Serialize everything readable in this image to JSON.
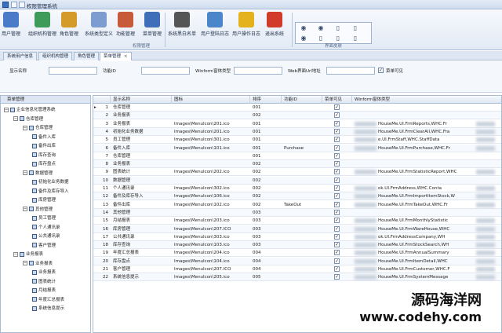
{
  "window": {
    "title": "权限管理系统"
  },
  "ribbon": {
    "buttons": [
      {
        "label": "用户管理",
        "icon": "users-icon",
        "color": "#4a7bc8"
      },
      {
        "label": "组织机构管理",
        "icon": "org-icon",
        "color": "#3f9b5a"
      },
      {
        "label": "角色管理",
        "icon": "role-icon",
        "color": "#d49a2a"
      },
      {
        "label": "系统类型定义",
        "icon": "type-define-icon",
        "color": "#7d9ccf"
      },
      {
        "label": "功能管理",
        "icon": "function-icon",
        "color": "#c85a3a"
      },
      {
        "label": "菜单管理",
        "icon": "menu-icon",
        "color": "#3f6fb8"
      },
      {
        "label": "系统黑白名单",
        "icon": "blacklist-icon",
        "color": "#555555"
      },
      {
        "label": "用户登陆日志",
        "icon": "login-log-icon",
        "color": "#4a86c9"
      },
      {
        "label": "用户操作日志",
        "icon": "warning-icon",
        "color": "#e3b21c"
      },
      {
        "label": "退出系统",
        "icon": "exit-icon",
        "color": "#d23a2a"
      }
    ],
    "group_label": "权限管理",
    "theme_label": "界面皮肤"
  },
  "tabs": [
    {
      "label": "系统用户信息"
    },
    {
      "label": "组织机构管理"
    },
    {
      "label": "角色管理"
    },
    {
      "label": "菜单管理",
      "close": "×"
    }
  ],
  "filter": {
    "display_name_label": "显示名称",
    "function_id_label": "功能ID",
    "winform_type_label": "Winform窗体类型",
    "web_url_label": "Web界面Url地址",
    "menu_visible_label": "菜单可见",
    "menu_visible_checked": true
  },
  "tree": {
    "title": "菜单管理",
    "nodes": [
      {
        "label": "企业信息化管理系统",
        "level": 0,
        "expanded": true
      },
      {
        "label": "仓库管理",
        "level": 1,
        "expanded": true
      },
      {
        "label": "仓库管理",
        "level": 2,
        "expanded": true
      },
      {
        "label": "备件入库",
        "level": 3
      },
      {
        "label": "备件出库",
        "level": 3
      },
      {
        "label": "库存查询",
        "level": 3
      },
      {
        "label": "库存盘点",
        "level": 3
      },
      {
        "label": "数据管理",
        "level": 2,
        "expanded": true
      },
      {
        "label": "初始化业务数据",
        "level": 3
      },
      {
        "label": "备件及库存导入",
        "level": 3
      },
      {
        "label": "库房管理",
        "level": 3
      },
      {
        "label": "其他管理",
        "level": 2,
        "expanded": true
      },
      {
        "label": "员工管理",
        "level": 3
      },
      {
        "label": "个人通讯录",
        "level": 3
      },
      {
        "label": "公共通讯录",
        "level": 3
      },
      {
        "label": "客户管理",
        "level": 3
      },
      {
        "label": "业务报表",
        "level": 1,
        "expanded": true
      },
      {
        "label": "业务报表",
        "level": 2,
        "expanded": true
      },
      {
        "label": "业务报表",
        "level": 3
      },
      {
        "label": "图表统计",
        "level": 3
      },
      {
        "label": "月结报表",
        "level": 3
      },
      {
        "label": "年度汇总报表",
        "level": 3
      },
      {
        "label": "系统信息提示",
        "level": 3
      }
    ]
  },
  "grid": {
    "columns": [
      "显示名称",
      "图标",
      "排序",
      "功能ID",
      "菜单可见",
      "Winform窗体类型"
    ],
    "current_row_marker": "▸",
    "check_mark": "✓",
    "rows": [
      {
        "n": "1",
        "name": "仓库管理",
        "icon": "",
        "sort": "001",
        "fid": "",
        "win": ""
      },
      {
        "n": "2",
        "name": "业务报表",
        "icon": "",
        "sort": "002",
        "fid": "",
        "win": ""
      },
      {
        "n": "3",
        "name": "业务报表",
        "icon": "Images\\MenuIcon\\201.ico",
        "sort": "001",
        "fid": "",
        "win": "HouseMe.UI.FrmReports,WHC.Fr"
      },
      {
        "n": "4",
        "name": "初始化业务数据",
        "icon": "Images\\MenuIcon\\201.ico",
        "sort": "001",
        "fid": "",
        "win": "HouseMe.UI.FrmClearAll,WHC.Fra"
      },
      {
        "n": "5",
        "name": "员工管理",
        "icon": "Images\\MenuIcon\\301.ico",
        "sort": "001",
        "fid": "",
        "win": "e.UI.FrmStaff,WHC.StaffData"
      },
      {
        "n": "6",
        "name": "备件入库",
        "icon": "Images\\MenuIcon\\101.ico",
        "sort": "001",
        "fid": "Purchase",
        "win": "HouseMe.UI.FrmPurchase,WHC.Fr"
      },
      {
        "n": "7",
        "name": "仓库管理",
        "icon": "",
        "sort": "001",
        "fid": "",
        "win": ""
      },
      {
        "n": "8",
        "name": "业务报表",
        "icon": "",
        "sort": "002",
        "fid": "",
        "win": ""
      },
      {
        "n": "9",
        "name": "图表统计",
        "icon": "Images\\MenuIcon\\202.ico",
        "sort": "002",
        "fid": "",
        "win": "HouseMe.UI.FrmStatisticReport,WHC"
      },
      {
        "n": "10",
        "name": "数据管理",
        "icon": "",
        "sort": "002",
        "fid": "",
        "win": ""
      },
      {
        "n": "11",
        "name": "个人通讯录",
        "icon": "Images\\MenuIcon\\302.ico",
        "sort": "002",
        "fid": "",
        "win": "ok.UI.FrmAddress,WHC.Conta"
      },
      {
        "n": "12",
        "name": "备件及库存导入",
        "icon": "Images\\MenuIcon\\106.ico",
        "sort": "002",
        "fid": "",
        "win": "HouseMe.UI.FrmImportItemStock,W"
      },
      {
        "n": "13",
        "name": "备件出库",
        "icon": "Images\\MenuIcon\\102.ico",
        "sort": "002",
        "fid": "TakeOut",
        "win": "HouseMe.UI.FrmTakeOut,WHC.Fr"
      },
      {
        "n": "14",
        "name": "其他管理",
        "icon": "",
        "sort": "003",
        "fid": "",
        "win": ""
      },
      {
        "n": "15",
        "name": "月结报表",
        "icon": "Images\\MenuIcon\\203.ico",
        "sort": "003",
        "fid": "",
        "win": "HouseMe.UI.FrmMonthlyStatistic"
      },
      {
        "n": "16",
        "name": "库房管理",
        "icon": "Images\\MenuIcon\\207.ICO",
        "sort": "003",
        "fid": "",
        "win": "HouseMe.UI.FrmWareHouse,WHC"
      },
      {
        "n": "17",
        "name": "公共通讯录",
        "icon": "Images\\MenuIcon\\303.ico",
        "sort": "003",
        "fid": "",
        "win": "ok.UI.FrmAddressCompany,WH"
      },
      {
        "n": "18",
        "name": "库存查询",
        "icon": "Images\\MenuIcon\\103.ico",
        "sort": "003",
        "fid": "",
        "win": "HouseMe.UI.FrmStockSearch,WH"
      },
      {
        "n": "19",
        "name": "年度汇总报表",
        "icon": "Images\\MenuIcon\\204.ico",
        "sort": "004",
        "fid": "",
        "win": "HouseMe.UI.FrmAnnualSummary"
      },
      {
        "n": "20",
        "name": "库存盘点",
        "icon": "Images\\MenuIcon\\104.ico",
        "sort": "004",
        "fid": "",
        "win": "HouseMe.UI.FrmItemDetail,WHC"
      },
      {
        "n": "21",
        "name": "客户管理",
        "icon": "Images\\MenuIcon\\207.ICO",
        "sort": "004",
        "fid": "",
        "win": "HouseMe.UI.FrmCustomer,WHC.F"
      },
      {
        "n": "22",
        "name": "系统信息提示",
        "icon": "Images\\MenuIcon\\205.ico",
        "sort": "005",
        "fid": "",
        "win": "HouseMe.UI.FrmSystemMessage"
      }
    ]
  },
  "watermark": {
    "line1": "源码海洋网",
    "line2": "www.codehy.com"
  }
}
